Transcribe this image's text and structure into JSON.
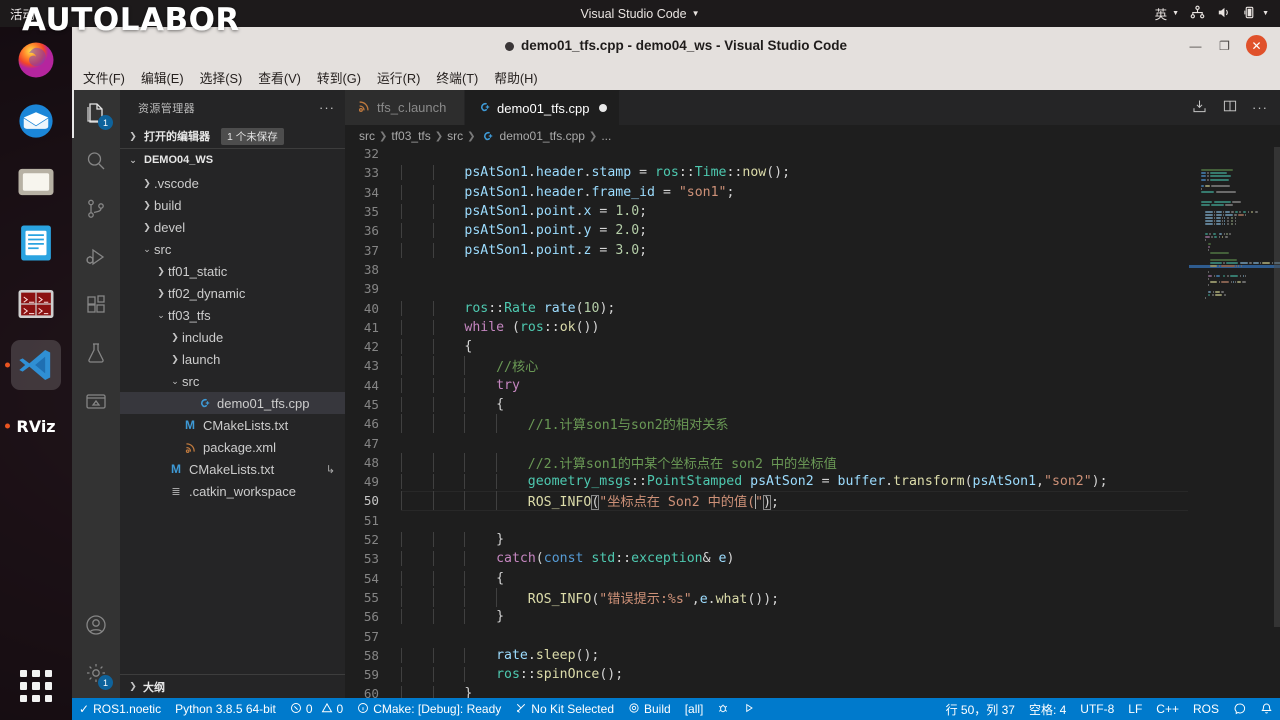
{
  "desktop": {
    "activities_label": "活动",
    "panel_app_title": "Visual Studio Code",
    "tray": {
      "input_method": "英",
      "network_icon": "network-icon",
      "volume_icon": "volume-icon",
      "battery_icon": "battery-icon"
    },
    "watermark": "AUTOLABOR",
    "dock_items": [
      {
        "name": "firefox",
        "label": "Firefox",
        "running": false
      },
      {
        "name": "thunderbird",
        "label": "Thunderbird",
        "running": false
      },
      {
        "name": "files",
        "label": "Files",
        "running": false
      },
      {
        "name": "libreoffice-writer",
        "label": "LibreOffice Writer",
        "running": false
      },
      {
        "name": "terminator",
        "label": "Terminator",
        "running": false
      },
      {
        "name": "vscode",
        "label": "Visual Studio Code",
        "running": true
      },
      {
        "name": "rviz",
        "label": "RViz",
        "running": true
      }
    ],
    "show_apps_label": "Show Applications"
  },
  "window": {
    "title": "demo01_tfs.cpp - demo04_ws - Visual Studio Code",
    "minimize_label": "—",
    "maximize_label": "❐",
    "close_label": "✕"
  },
  "menubar": {
    "items": [
      "文件(F)",
      "编辑(E)",
      "选择(S)",
      "查看(V)",
      "转到(G)",
      "运行(R)",
      "终端(T)",
      "帮助(H)"
    ]
  },
  "activitybar": {
    "items": [
      {
        "name": "explorer",
        "icon": "files-icon",
        "active": true,
        "badge": "1"
      },
      {
        "name": "search",
        "icon": "search-icon",
        "active": false,
        "badge": ""
      },
      {
        "name": "source-control",
        "icon": "source-control-icon",
        "active": false,
        "badge": ""
      },
      {
        "name": "run-debug",
        "icon": "run-debug-icon",
        "active": false,
        "badge": ""
      },
      {
        "name": "extensions",
        "icon": "extensions-icon",
        "active": false,
        "badge": ""
      },
      {
        "name": "testing",
        "icon": "beaker-icon",
        "active": false,
        "badge": ""
      },
      {
        "name": "remote-explorer",
        "icon": "remote-icon",
        "active": false,
        "badge": ""
      }
    ],
    "bottom_items": [
      {
        "name": "accounts",
        "icon": "account-icon",
        "badge": ""
      },
      {
        "name": "settings",
        "icon": "gear-icon",
        "badge": "1"
      }
    ]
  },
  "sidebar": {
    "header": "资源管理器",
    "more_actions": "···",
    "open_editors": {
      "label": "打开的编辑器",
      "badge": "1 个未保存"
    },
    "workspace_root": "DEMO04_WS",
    "tree": [
      {
        "label": ".vscode",
        "depth": 1,
        "kind": "folder",
        "expanded": false
      },
      {
        "label": "build",
        "depth": 1,
        "kind": "folder",
        "expanded": false
      },
      {
        "label": "devel",
        "depth": 1,
        "kind": "folder",
        "expanded": false
      },
      {
        "label": "src",
        "depth": 1,
        "kind": "folder",
        "expanded": true
      },
      {
        "label": "tf01_static",
        "depth": 2,
        "kind": "folder",
        "expanded": false
      },
      {
        "label": "tf02_dynamic",
        "depth": 2,
        "kind": "folder",
        "expanded": false
      },
      {
        "label": "tf03_tfs",
        "depth": 2,
        "kind": "folder",
        "expanded": true
      },
      {
        "label": "include",
        "depth": 3,
        "kind": "folder",
        "expanded": false
      },
      {
        "label": "launch",
        "depth": 3,
        "kind": "folder",
        "expanded": false
      },
      {
        "label": "src",
        "depth": 3,
        "kind": "folder",
        "expanded": true
      },
      {
        "label": "demo01_tfs.cpp",
        "depth": 4,
        "kind": "cpp",
        "selected": true
      },
      {
        "label": "CMakeLists.txt",
        "depth": 3,
        "kind": "cmake"
      },
      {
        "label": "package.xml",
        "depth": 3,
        "kind": "xml"
      },
      {
        "label": "CMakeLists.txt",
        "depth": 2,
        "kind": "cmake",
        "right_icon": "↳"
      },
      {
        "label": ".catkin_workspace",
        "depth": 2,
        "kind": "text"
      }
    ],
    "outline_label": "大纲"
  },
  "editor": {
    "tabs": [
      {
        "label": "tfs_c.launch",
        "icon": "xml-icon",
        "active": false,
        "dirty": false
      },
      {
        "label": "demo01_tfs.cpp",
        "icon": "cpp-icon",
        "active": true,
        "dirty": true
      }
    ],
    "actions": [
      {
        "name": "run-build-task-icon",
        "label": "⏷"
      },
      {
        "name": "split-editor-icon",
        "label": "▯▯"
      },
      {
        "name": "more-actions-icon",
        "label": "···"
      }
    ],
    "breadcrumb": [
      "src",
      "tf03_tfs",
      "src",
      "demo01_tfs.cpp",
      "..."
    ],
    "partial_top_line": "32",
    "partial_bottom_line": "61",
    "code_lines": [
      {
        "n": "33",
        "indent": 2,
        "tokens": [
          {
            "t": "psAtSon1",
            "c": "t-var"
          },
          {
            "t": ".",
            "c": "t-plain"
          },
          {
            "t": "header",
            "c": "t-var"
          },
          {
            "t": ".",
            "c": "t-plain"
          },
          {
            "t": "stamp",
            "c": "t-var"
          },
          {
            "t": " = ",
            "c": "t-plain"
          },
          {
            "t": "ros",
            "c": "t-ns"
          },
          {
            "t": "::",
            "c": "t-plain"
          },
          {
            "t": "Time",
            "c": "t-ns"
          },
          {
            "t": "::",
            "c": "t-plain"
          },
          {
            "t": "now",
            "c": "t-fn"
          },
          {
            "t": "();",
            "c": "t-plain"
          }
        ]
      },
      {
        "n": "34",
        "indent": 2,
        "tokens": [
          {
            "t": "psAtSon1",
            "c": "t-var"
          },
          {
            "t": ".",
            "c": "t-plain"
          },
          {
            "t": "header",
            "c": "t-var"
          },
          {
            "t": ".",
            "c": "t-plain"
          },
          {
            "t": "frame_id",
            "c": "t-var"
          },
          {
            "t": " = ",
            "c": "t-plain"
          },
          {
            "t": "\"son1\"",
            "c": "t-str"
          },
          {
            "t": ";",
            "c": "t-plain"
          }
        ]
      },
      {
        "n": "35",
        "indent": 2,
        "tokens": [
          {
            "t": "psAtSon1",
            "c": "t-var"
          },
          {
            "t": ".",
            "c": "t-plain"
          },
          {
            "t": "point",
            "c": "t-var"
          },
          {
            "t": ".",
            "c": "t-plain"
          },
          {
            "t": "x",
            "c": "t-var"
          },
          {
            "t": " = ",
            "c": "t-plain"
          },
          {
            "t": "1.0",
            "c": "t-num"
          },
          {
            "t": ";",
            "c": "t-plain"
          }
        ]
      },
      {
        "n": "36",
        "indent": 2,
        "tokens": [
          {
            "t": "psAtSon1",
            "c": "t-var"
          },
          {
            "t": ".",
            "c": "t-plain"
          },
          {
            "t": "point",
            "c": "t-var"
          },
          {
            "t": ".",
            "c": "t-plain"
          },
          {
            "t": "y",
            "c": "t-var"
          },
          {
            "t": " = ",
            "c": "t-plain"
          },
          {
            "t": "2.0",
            "c": "t-num"
          },
          {
            "t": ";",
            "c": "t-plain"
          }
        ]
      },
      {
        "n": "37",
        "indent": 2,
        "tokens": [
          {
            "t": "psAtSon1",
            "c": "t-var"
          },
          {
            "t": ".",
            "c": "t-plain"
          },
          {
            "t": "point",
            "c": "t-var"
          },
          {
            "t": ".",
            "c": "t-plain"
          },
          {
            "t": "z",
            "c": "t-var"
          },
          {
            "t": " = ",
            "c": "t-plain"
          },
          {
            "t": "3.0",
            "c": "t-num"
          },
          {
            "t": ";",
            "c": "t-plain"
          }
        ]
      },
      {
        "n": "38",
        "indent": 0,
        "tokens": []
      },
      {
        "n": "39",
        "indent": 0,
        "tokens": []
      },
      {
        "n": "40",
        "indent": 2,
        "tokens": [
          {
            "t": "ros",
            "c": "t-ns"
          },
          {
            "t": "::",
            "c": "t-plain"
          },
          {
            "t": "Rate",
            "c": "t-type"
          },
          {
            "t": " ",
            "c": "t-plain"
          },
          {
            "t": "rate",
            "c": "t-var"
          },
          {
            "t": "(",
            "c": "t-plain"
          },
          {
            "t": "10",
            "c": "t-num"
          },
          {
            "t": ");",
            "c": "t-plain"
          }
        ]
      },
      {
        "n": "41",
        "indent": 2,
        "tokens": [
          {
            "t": "while",
            "c": "t-kw"
          },
          {
            "t": " (",
            "c": "t-plain"
          },
          {
            "t": "ros",
            "c": "t-ns"
          },
          {
            "t": "::",
            "c": "t-plain"
          },
          {
            "t": "ok",
            "c": "t-fn"
          },
          {
            "t": "())",
            "c": "t-plain"
          }
        ]
      },
      {
        "n": "42",
        "indent": 2,
        "tokens": [
          {
            "t": "{",
            "c": "t-plain"
          }
        ]
      },
      {
        "n": "43",
        "indent": 3,
        "tokens": [
          {
            "t": "//核心",
            "c": "t-cmt"
          }
        ]
      },
      {
        "n": "44",
        "indent": 3,
        "tokens": [
          {
            "t": "try",
            "c": "t-kw"
          }
        ]
      },
      {
        "n": "45",
        "indent": 3,
        "tokens": [
          {
            "t": "{",
            "c": "t-plain"
          }
        ]
      },
      {
        "n": "46",
        "indent": 4,
        "tokens": [
          {
            "t": "//1.计算son1与son2的相对关系",
            "c": "t-cmt"
          }
        ]
      },
      {
        "n": "47",
        "indent": 0,
        "tokens": []
      },
      {
        "n": "48",
        "indent": 4,
        "tokens": [
          {
            "t": "//2.计算son1的中某个坐标点在 son2 中的坐标值",
            "c": "t-cmt"
          }
        ]
      },
      {
        "n": "49",
        "indent": 4,
        "tokens": [
          {
            "t": "geometry_msgs",
            "c": "t-ns"
          },
          {
            "t": "::",
            "c": "t-plain"
          },
          {
            "t": "PointStamped",
            "c": "t-type"
          },
          {
            "t": " ",
            "c": "t-plain"
          },
          {
            "t": "psAtSon2",
            "c": "t-var"
          },
          {
            "t": " = ",
            "c": "t-plain"
          },
          {
            "t": "buffer",
            "c": "t-var"
          },
          {
            "t": ".",
            "c": "t-plain"
          },
          {
            "t": "transform",
            "c": "t-fn"
          },
          {
            "t": "(",
            "c": "t-plain"
          },
          {
            "t": "psAtSon1",
            "c": "t-var"
          },
          {
            "t": ",",
            "c": "t-plain"
          },
          {
            "t": "\"son2\"",
            "c": "t-str"
          },
          {
            "t": ");",
            "c": "t-plain"
          }
        ]
      },
      {
        "n": "50",
        "current": true,
        "indent": 4,
        "tokens": [
          {
            "t": "ROS_INFO",
            "c": "t-fn"
          },
          {
            "t": "(",
            "c": "t-plain",
            "match": true
          },
          {
            "t": "\"坐标点在 Son2 中的值(",
            "c": "t-str"
          },
          {
            "t": "CARET",
            "c": "caret"
          },
          {
            "t": "\"",
            "c": "t-str"
          },
          {
            "t": ")",
            "c": "t-plain",
            "match": true
          },
          {
            "t": ";",
            "c": "t-plain"
          }
        ]
      },
      {
        "n": "51",
        "indent": 0,
        "tokens": []
      },
      {
        "n": "52",
        "indent": 3,
        "tokens": [
          {
            "t": "}",
            "c": "t-plain"
          }
        ]
      },
      {
        "n": "53",
        "indent": 3,
        "tokens": [
          {
            "t": "catch",
            "c": "t-kw"
          },
          {
            "t": "(",
            "c": "t-plain"
          },
          {
            "t": "const",
            "c": "t-kw2"
          },
          {
            "t": " ",
            "c": "t-plain"
          },
          {
            "t": "std",
            "c": "t-ns"
          },
          {
            "t": "::",
            "c": "t-plain"
          },
          {
            "t": "exception",
            "c": "t-type"
          },
          {
            "t": "& ",
            "c": "t-plain"
          },
          {
            "t": "e",
            "c": "t-var"
          },
          {
            "t": ")",
            "c": "t-plain"
          }
        ]
      },
      {
        "n": "54",
        "indent": 3,
        "tokens": [
          {
            "t": "{",
            "c": "t-plain"
          }
        ]
      },
      {
        "n": "55",
        "indent": 4,
        "tokens": [
          {
            "t": "ROS_INFO",
            "c": "t-fn"
          },
          {
            "t": "(",
            "c": "t-plain"
          },
          {
            "t": "\"错误提示:%s\"",
            "c": "t-str"
          },
          {
            "t": ",",
            "c": "t-plain"
          },
          {
            "t": "e",
            "c": "t-var"
          },
          {
            "t": ".",
            "c": "t-plain"
          },
          {
            "t": "what",
            "c": "t-fn"
          },
          {
            "t": "());",
            "c": "t-plain"
          }
        ]
      },
      {
        "n": "56",
        "indent": 3,
        "tokens": [
          {
            "t": "}",
            "c": "t-plain"
          }
        ]
      },
      {
        "n": "57",
        "indent": 0,
        "tokens": []
      },
      {
        "n": "58",
        "indent": 3,
        "tokens": [
          {
            "t": "rate",
            "c": "t-var"
          },
          {
            "t": ".",
            "c": "t-plain"
          },
          {
            "t": "sleep",
            "c": "t-fn"
          },
          {
            "t": "();",
            "c": "t-plain"
          }
        ]
      },
      {
        "n": "59",
        "indent": 3,
        "tokens": [
          {
            "t": "ros",
            "c": "t-ns"
          },
          {
            "t": "::",
            "c": "t-plain"
          },
          {
            "t": "spinOnce",
            "c": "t-fn"
          },
          {
            "t": "();",
            "c": "t-plain"
          }
        ]
      },
      {
        "n": "60",
        "indent": 2,
        "tokens": [
          {
            "t": "}",
            "c": "t-plain"
          }
        ]
      }
    ]
  },
  "statusbar": {
    "left": [
      {
        "name": "ros-distro",
        "icon": "check-icon",
        "label": "ROS1.noetic"
      },
      {
        "name": "python-version",
        "icon": "",
        "label": "Python 3.8.5 64-bit"
      },
      {
        "name": "problems",
        "icon": "error-warn",
        "label": "0  0",
        "errors": "0",
        "warnings": "0"
      },
      {
        "name": "cmake-status",
        "icon": "info-icon",
        "label": "CMake: [Debug]: Ready"
      },
      {
        "name": "cmake-kit",
        "icon": "tools-icon",
        "label": "No Kit Selected"
      },
      {
        "name": "cmake-build",
        "icon": "gear-icon",
        "label": "Build"
      },
      {
        "name": "cmake-target",
        "icon": "",
        "label": "[all]"
      },
      {
        "name": "cmake-debug",
        "icon": "bug-icon",
        "label": ""
      },
      {
        "name": "cmake-run",
        "icon": "play-icon",
        "label": ""
      }
    ],
    "right": [
      {
        "name": "cursor-position",
        "label": "行 50，列 37"
      },
      {
        "name": "indentation",
        "label": "空格: 4"
      },
      {
        "name": "encoding",
        "label": "UTF-8"
      },
      {
        "name": "eol",
        "label": "LF"
      },
      {
        "name": "language-mode",
        "label": "C++"
      },
      {
        "name": "ros-status",
        "label": "ROS"
      },
      {
        "name": "feedback",
        "icon": "feedback-icon",
        "label": ""
      },
      {
        "name": "notifications",
        "icon": "bell-icon",
        "label": ""
      }
    ]
  },
  "colors": {
    "statusbar_bg": "#007acc",
    "accent": "#0e639c",
    "titlebar_bg": "#e4e0dd",
    "editor_bg": "#1e1e1e",
    "sidebar_bg": "#252526",
    "activitybar_bg": "#333333",
    "ubuntu_orange": "#e95420"
  }
}
